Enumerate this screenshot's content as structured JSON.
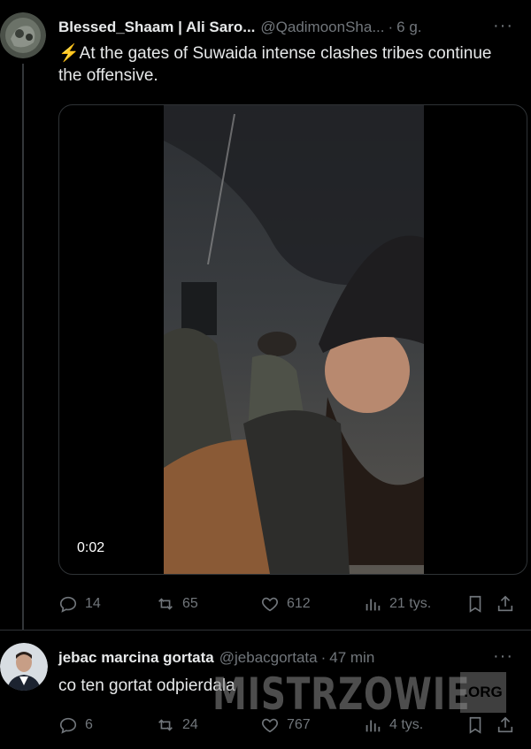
{
  "tweet1": {
    "author_name": "Blessed_Shaam | Ali Saro...",
    "handle": "@QadimoonSha...",
    "separator": "·",
    "time": "6 g.",
    "more": "···",
    "text_emoji": "⚡",
    "text": "At the gates of Suwaida intense clashes tribes continue the offensive.",
    "video_duration": "0:02",
    "stats": {
      "replies": "14",
      "reposts": "65",
      "likes": "612",
      "views": "21 tys."
    }
  },
  "tweet2": {
    "author_name": "jebac marcina gortata",
    "handle": "@jebacgortata",
    "separator": "·",
    "time": "47 min",
    "more": "···",
    "text": "co ten gortat odpierdala",
    "stats": {
      "replies": "6",
      "reposts": "24",
      "likes": "767",
      "views": "4 tys."
    }
  },
  "watermark": {
    "text": "MISTRZOWIE",
    "badge": ".ORG"
  },
  "colors": {
    "background": "#000000",
    "text": "#e7e9ea",
    "muted": "#71767b",
    "border": "#2f3336"
  },
  "icons": [
    "reply-icon",
    "repost-icon",
    "like-icon",
    "views-icon",
    "bookmark-icon",
    "share-icon",
    "more-icon"
  ]
}
